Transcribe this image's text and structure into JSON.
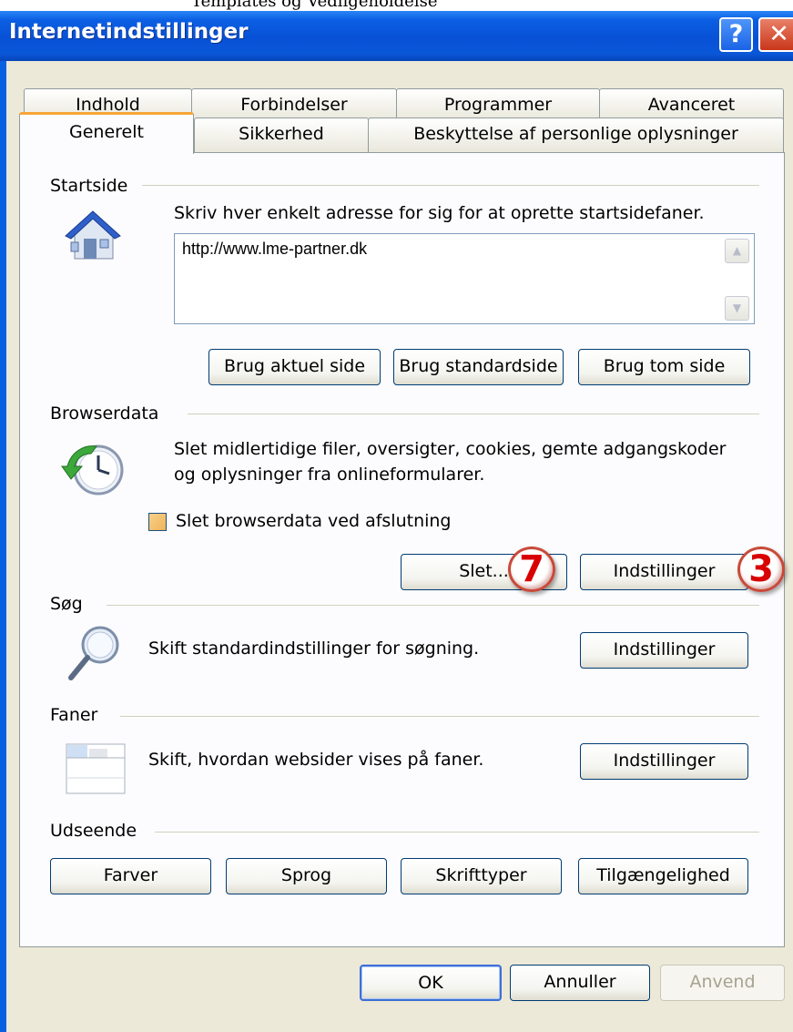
{
  "window": {
    "title": "Internetindstillinger",
    "help_label": "?",
    "close_label": "✕"
  },
  "tabs": {
    "row1": [
      "Indhold",
      "Forbindelser",
      "Programmer",
      "Avanceret"
    ],
    "row2": [
      "Generelt",
      "Sikkerhed",
      "Beskyttelse af personlige oplysninger"
    ],
    "active": "Generelt"
  },
  "startside": {
    "label": "Startside",
    "icon": "house-icon",
    "description": "Skriv hver enkelt adresse for sig for at oprette startsidefaner.",
    "address_value": "http://www.lme-partner.dk",
    "buttons": [
      "Brug aktuel side",
      "Brug standardside",
      "Brug tom side"
    ]
  },
  "browserdata": {
    "label": "Browserdata",
    "icon": "clock-refresh-icon",
    "description_line1": "Slet midlertidige filer, oversigter, cookies, gemte adgangskoder",
    "description_line2": "og oplysninger fra onlineformularer.",
    "checkbox_label": "Slet browserdata ved afslutning",
    "checkbox_checked": false,
    "delete_button": "Slet...",
    "settings_button": "Indstillinger"
  },
  "soeg": {
    "label": "Søg",
    "icon": "magnifier-icon",
    "description": "Skift standardindstillinger for søgning.",
    "settings_button": "Indstillinger"
  },
  "faner": {
    "label": "Faner",
    "icon": "tabs-window-icon",
    "description": "Skift, hvordan websider vises på faner.",
    "settings_button": "Indstillinger"
  },
  "udseende": {
    "label": "Udseende",
    "buttons": [
      "Farver",
      "Sprog",
      "Skrifttyper",
      "Tilgængelighed"
    ]
  },
  "annotations": {
    "badge_delete": "7",
    "badge_settings": "3",
    "badge_color": "#d80000"
  },
  "footer": {
    "ok": "OK",
    "cancel": "Annuller",
    "apply": "Anvend"
  }
}
